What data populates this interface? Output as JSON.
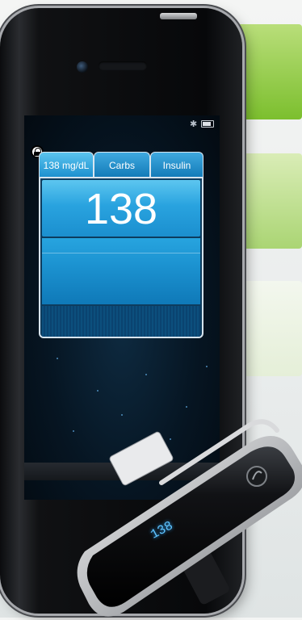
{
  "app": {
    "tabs": [
      {
        "label": "138 mg/dL",
        "active": true
      },
      {
        "label": "Carbs",
        "active": false
      },
      {
        "label": "Insulin",
        "active": false
      }
    ],
    "reading_value": "138"
  },
  "device": {
    "meter_display": "138"
  },
  "icons": [
    "lock-icon",
    "bluetooth-icon",
    "battery-icon"
  ],
  "colors": {
    "accent_blue": "#1b8fce",
    "tile_green": "#7cbf2e"
  }
}
